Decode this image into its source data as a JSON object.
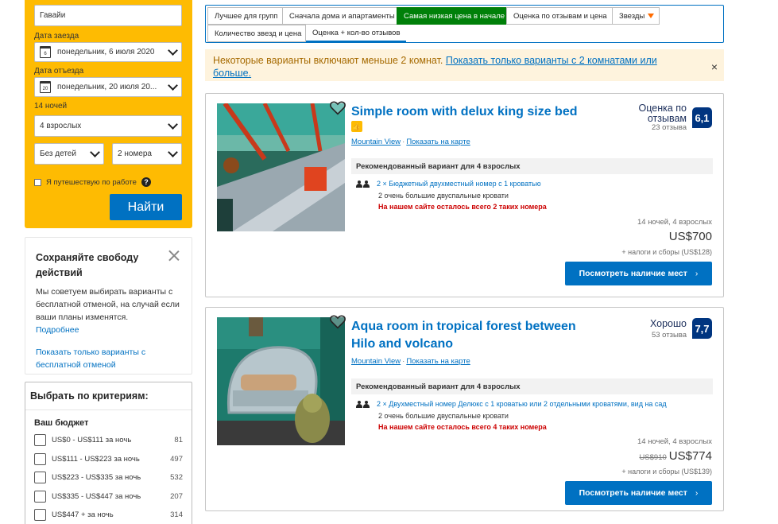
{
  "search": {
    "destination": "Гавайи",
    "checkin_label": "Дата заезда",
    "checkin_value": "понедельник, 6 июля 2020",
    "checkin_day": "6",
    "checkout_label": "Дата отъезда",
    "checkout_value": "понедельник, 20 июля 20...",
    "checkout_day": "20",
    "nights": "14 ночей",
    "adults": "4 взрослых",
    "children": "Без детей",
    "rooms": "2 номера",
    "work_trip": "Я путешествую по работе",
    "help_glyph": "?",
    "submit": "Найти"
  },
  "cancel_box": {
    "title": "Сохраняйте свободу действий",
    "text": "Мы советуем выбирать варианты с бесплатной отменой, на случай если ваши планы изменятся.",
    "more": "Подробнее",
    "link": "Показать только варианты с бесплатной отменой"
  },
  "filters": {
    "title": "Выбрать по критериям:",
    "budget_title": "Ваш бюджет",
    "items": [
      {
        "label": "US$0 - US$111 за ночь",
        "count": "81"
      },
      {
        "label": "US$111 - US$223 за ночь",
        "count": "497"
      },
      {
        "label": "US$223 - US$335 за ночь",
        "count": "532"
      },
      {
        "label": "US$335 - US$447 за ночь",
        "count": "207"
      },
      {
        "label": "US$447 + за ночь",
        "count": "314"
      }
    ]
  },
  "sort": {
    "tabs": [
      "Лучшее для групп",
      "Сначала дома и апартаменты",
      "Самая низкая цена в начале",
      "Оценка по отзывам и цена",
      "Звезды",
      "Количество звезд и цена",
      "Оценка + кол-во отзывов"
    ]
  },
  "notice": {
    "text": "Некоторые варианты включают меньше 2 комнат.",
    "link": "Показать только варианты с 2 комнатами или больше.",
    "close": "×"
  },
  "results": [
    {
      "title": "Simple room with delux king size bed",
      "location": "Mountain View",
      "map_link": "Показать на карте",
      "score_label": "Оценка по отзывам",
      "reviews": "23 отзыва",
      "score": "6,1",
      "rec_header": "Рекомендованный вариант для 4 взрослых",
      "room": "2 × Бюджетный двухместный номер с 1 кроватью",
      "beds": "2 очень большие двуспальные кровати",
      "left": "На нашем сайте осталось всего 2 таких номера",
      "nights": "14 ночей, 4 взрослых",
      "old_price": "",
      "price": "US$700",
      "taxes": "+ налоги и сборы (US$128)",
      "cta": "Посмотреть наличие мест",
      "cta_arrow": "›"
    },
    {
      "title": "Aqua room in tropical forest between Hilo and volcano",
      "location": "Mountain View",
      "map_link": "Показать на карте",
      "score_label": "Хорошо",
      "reviews": "53 отзыва",
      "score": "7,7",
      "rec_header": "Рекомендованный вариант для 4 взрослых",
      "room": "2 × Двухместный номер Делюкс с 1 кроватью или 2 отдельными кроватями, вид на сад",
      "beds": "2 очень большие двуспальные кровати",
      "left": "На нашем сайте осталось всего 4 таких номера",
      "nights": "14 ночей, 4 взрослых",
      "old_price": "US$910",
      "price": "US$774",
      "taxes": "+ налоги и сборы (US$139)",
      "cta": "Посмотреть наличие мест",
      "cta_arrow": "›"
    }
  ],
  "colors": {
    "brand_yellow": "#febb02",
    "brand_blue": "#0071c2",
    "active_sort": "#008009",
    "score_navy": "#003580",
    "urgency_red": "#cc0000"
  }
}
